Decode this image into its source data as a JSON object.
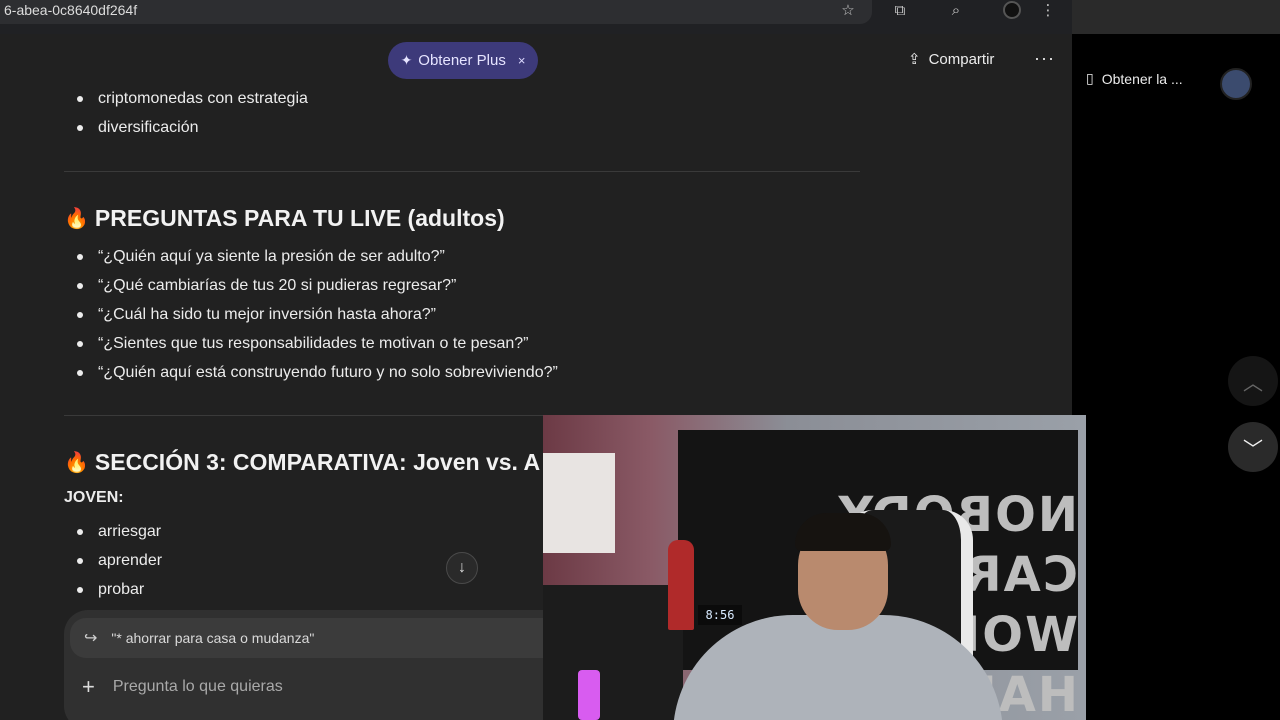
{
  "browser": {
    "url_fragment": "6-abea-0c8640df264f",
    "toolbar_icons": [
      "star-icon",
      "extension-icon",
      "tab-search-icon",
      "profile-icon",
      "menu-icon"
    ]
  },
  "header": {
    "plus_label": "Obtener Plus",
    "plus_close": "×",
    "share_label": "Compartir",
    "more_label": "···"
  },
  "content": {
    "top_bullets": [
      "criptomonedas con estrategia",
      "diversificación"
    ],
    "section2_title": "PREGUNTAS PARA TU LIVE (adultos)",
    "section2_bullets": [
      "“¿Quién aquí ya siente la presión de ser adulto?”",
      "“¿Qué cambiarías de tus 20 si pudieras regresar?”",
      "“¿Cuál ha sido tu mejor inversión hasta ahora?”",
      "“¿Sientes que tus responsabilidades te motivan o te pesan?”",
      "“¿Quién aquí está construyendo futuro y no solo sobreviviendo?”"
    ],
    "section3_title": "SECCIÓN 3: COMPARATIVA: Joven vs. A",
    "section3_subhead": "JOVEN:",
    "section3_bullets": [
      "arriesgar",
      "aprender",
      "probar"
    ]
  },
  "composer": {
    "quote_text": "\"* ahorrar para casa o mudanza\"",
    "placeholder": "Pregunta lo que quieras"
  },
  "side_window": {
    "download_label": "Obtener la ...",
    "nav_up": "︿",
    "nav_down": "﹀"
  },
  "webcam": {
    "banner_text_line1": "NOBODY CARES",
    "banner_text_line2": "WORK HARDER",
    "clock": "8:56"
  }
}
